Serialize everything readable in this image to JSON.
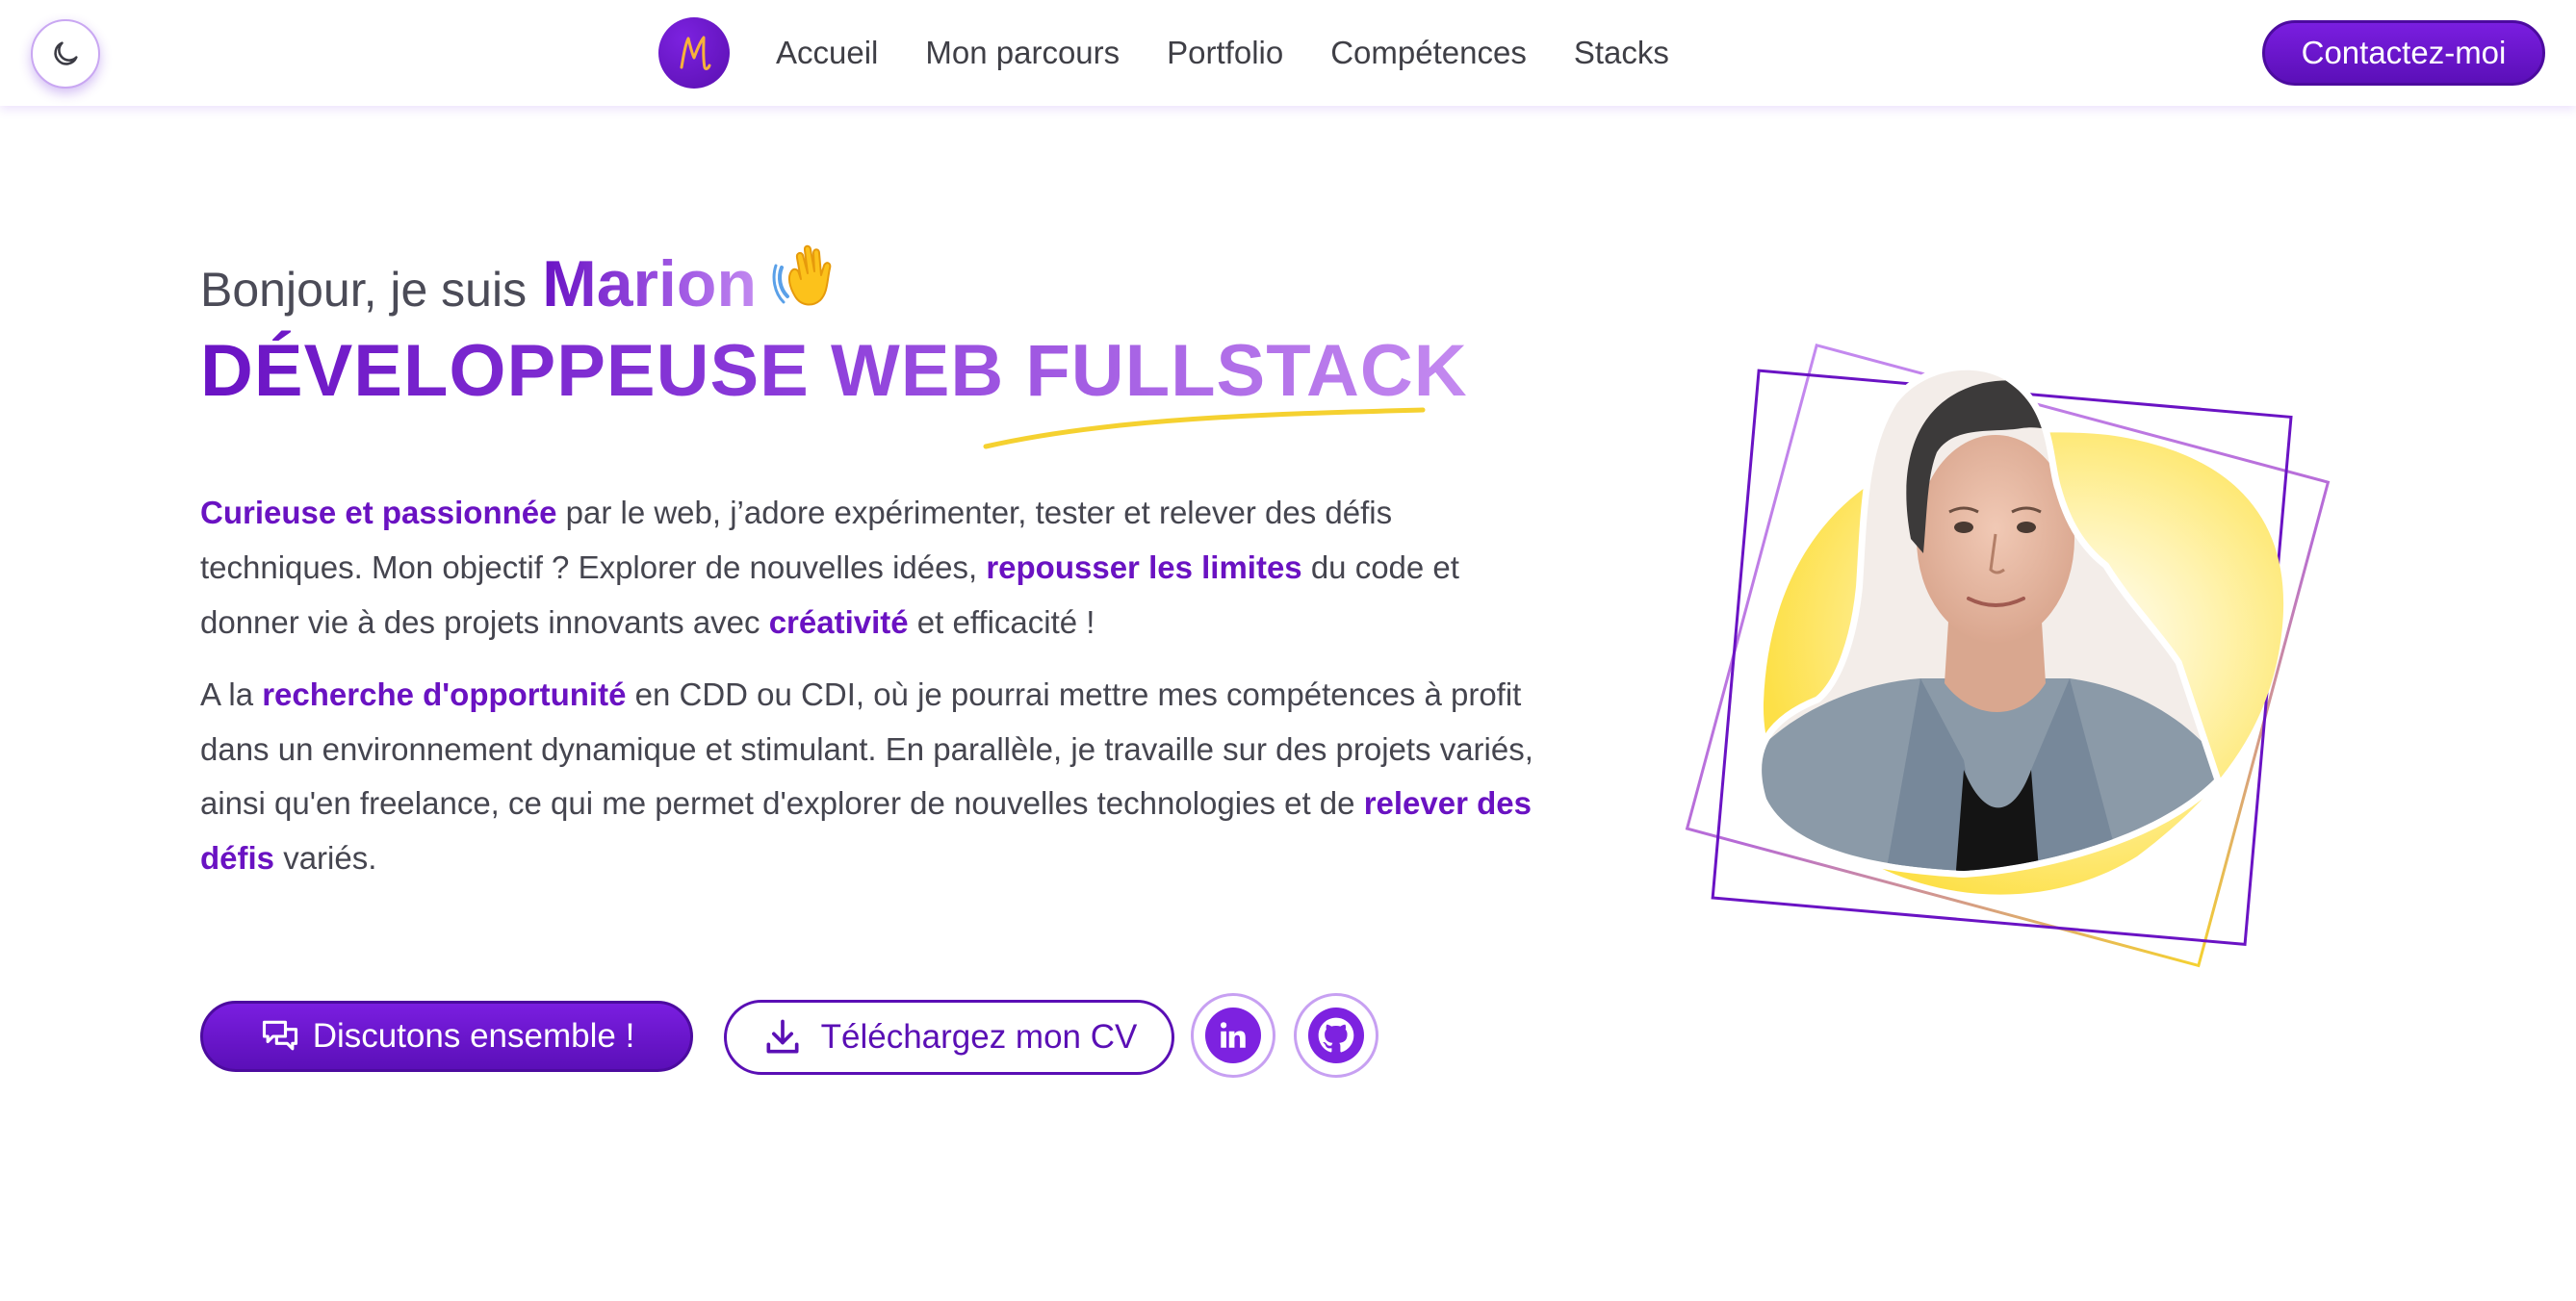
{
  "header": {
    "theme_toggle_icon": "moon-icon",
    "logo_letter": "M",
    "nav": [
      "Accueil",
      "Mon parcours",
      "Portfolio",
      "Compétences",
      "Stacks"
    ],
    "contact_label": "Contactez-moi"
  },
  "hero": {
    "greeting": "Bonjour, je suis",
    "name": "Marion",
    "wave_icon": "waving-hand-emoji",
    "title": "DÉVELOPPEUSE WEB FULLSTACK",
    "para1": {
      "hl1": "Curieuse et passionnée",
      "t1": " par le web, j’adore expérimenter, tester et relever des défis techniques. Mon objectif ? Explorer de nouvelles idées, ",
      "hl2": "repousser les limites",
      "t2": " du code et donner vie à des projets innovants avec ",
      "hl3": "créativité",
      "t3": " et efficacité !"
    },
    "para2": {
      "t0": "A la ",
      "hl1": "recherche d'opportunité",
      "t1": " en CDD ou CDI, où je pourrai mettre mes compétences à profit dans un environnement dynamique et stimulant. En parallèle, je travaille sur des projets variés, ainsi qu'en freelance, ce qui me permet d'explorer de nouvelles technologies et de ",
      "hl2": "relever des défis",
      "t2": " variés."
    },
    "cta_discuss": "Discutons ensemble !",
    "cta_cv": "Téléchargez mon CV",
    "social": [
      "linkedin-icon",
      "github-icon"
    ]
  },
  "colors": {
    "primary": "#6a13c4",
    "primary_light": "#c28af0",
    "accent_yellow": "#fde047"
  }
}
